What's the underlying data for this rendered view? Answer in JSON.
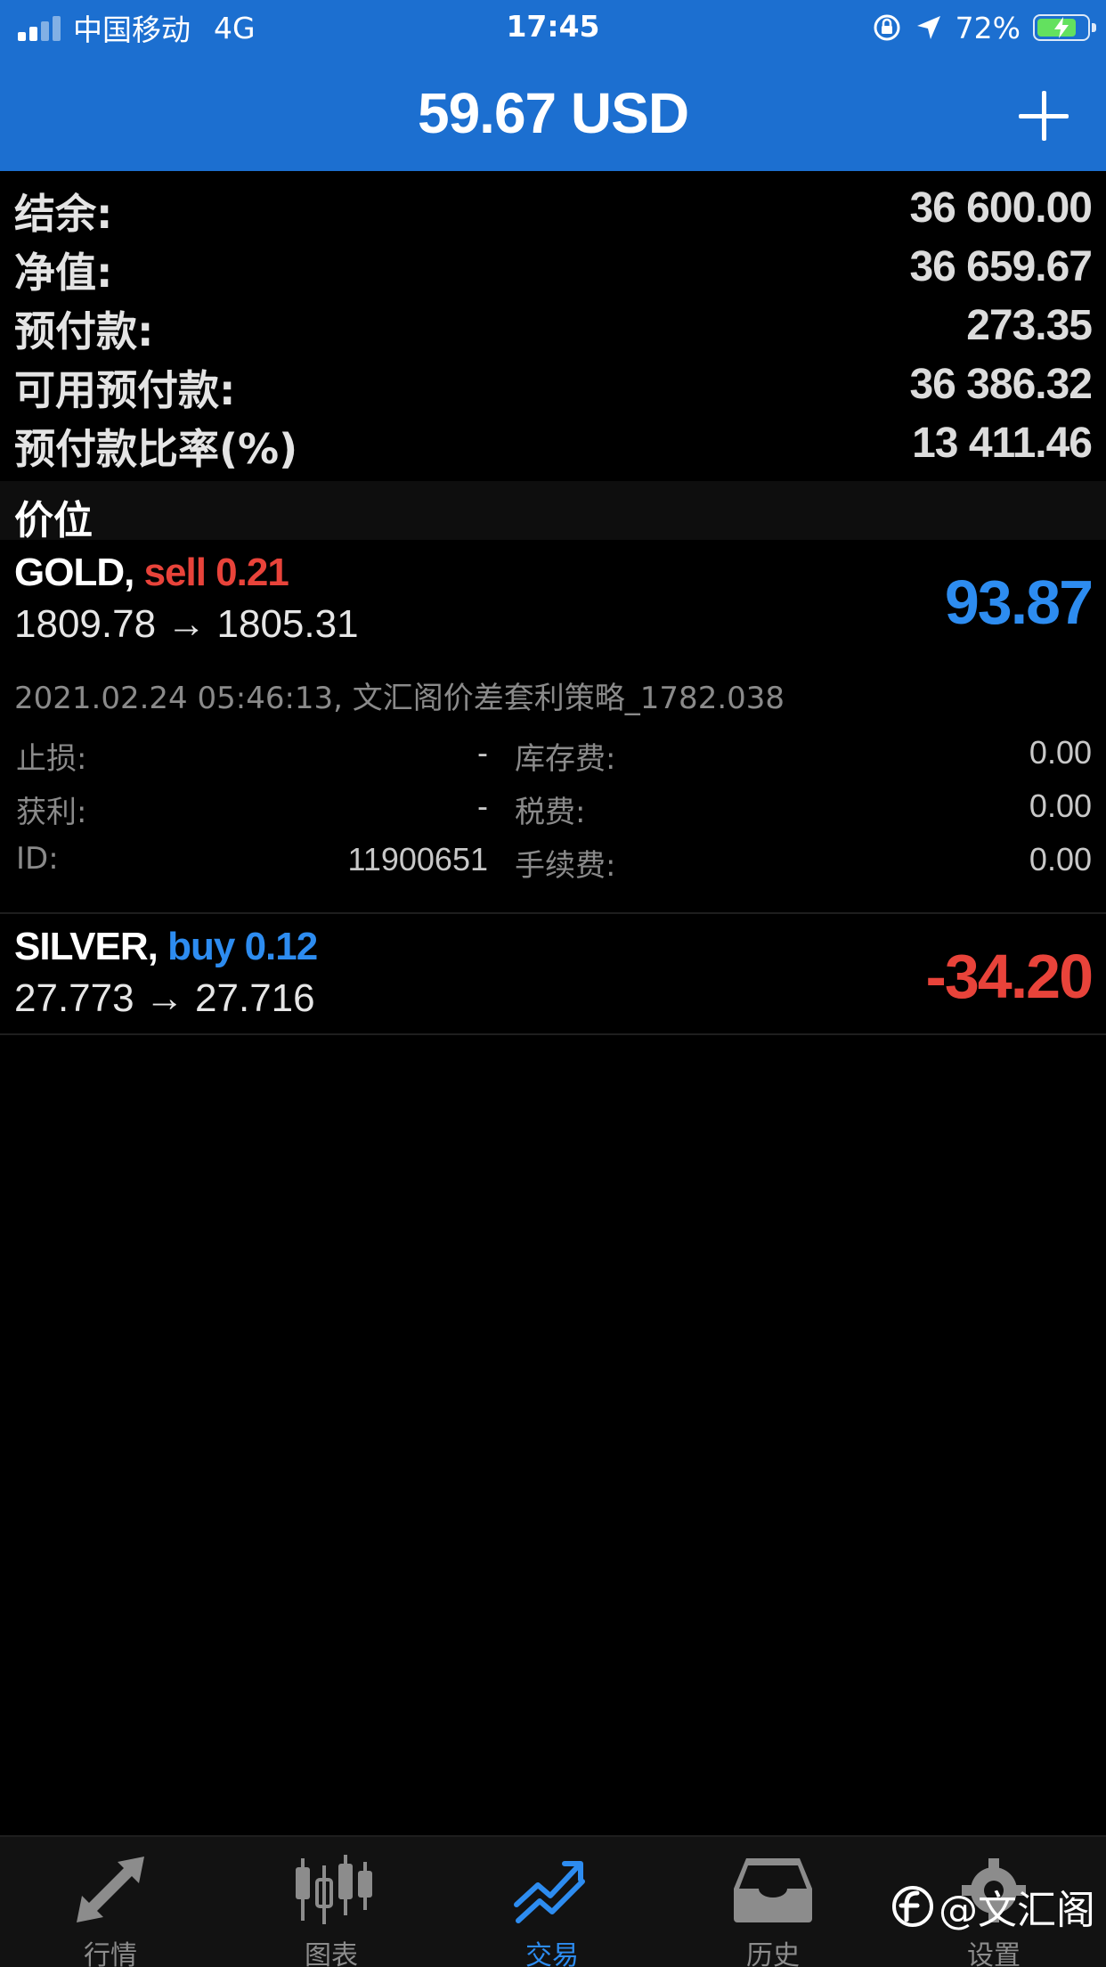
{
  "status_bar": {
    "carrier": "中国移动",
    "network": "4G",
    "time": "17:45",
    "battery": "72%"
  },
  "header": {
    "title": "59.67 USD"
  },
  "summary": [
    {
      "label": "结余:",
      "value": "36 600.00"
    },
    {
      "label": "净值:",
      "value": "36 659.67"
    },
    {
      "label": "预付款:",
      "value": "273.35"
    },
    {
      "label": "可用预付款:",
      "value": "36 386.32"
    },
    {
      "label": "预付款比率(%)",
      "value": "13 411.46"
    }
  ],
  "section": {
    "title": "价位"
  },
  "positions": [
    {
      "symbol": "GOLD,",
      "side": "sell 0.21",
      "prices": "1809.78 → 1805.31",
      "profit": "93.87",
      "comment": "2021.02.24 05:46:13, 文汇阁价差套利策略_1782.038",
      "details": {
        "sl_label": "止损:",
        "sl_value": "-",
        "tp_label": "获利:",
        "tp_value": "-",
        "id_label": "ID:",
        "id_value": "11900651",
        "swap_label": "库存费:",
        "swap_value": "0.00",
        "tax_label": "税费:",
        "tax_value": "0.00",
        "commission_label": "手续费:",
        "commission_value": "0.00"
      }
    },
    {
      "symbol": "SILVER,",
      "side": "buy 0.12",
      "prices": "27.773 → 27.716",
      "profit": "-34.20"
    }
  ],
  "tabs": [
    {
      "label": "行情",
      "icon": "quotes-arrows-icon"
    },
    {
      "label": "图表",
      "icon": "candlestick-chart-icon"
    },
    {
      "label": "交易",
      "icon": "trade-chart-icon"
    },
    {
      "label": "历史",
      "icon": "history-inbox-icon"
    },
    {
      "label": "设置",
      "icon": "gear-icon"
    }
  ],
  "watermark": "@文汇阁",
  "colors": {
    "header_blue": "#1c6fd0",
    "profit_blue": "#2d8cf0",
    "loss_red": "#e8433a"
  }
}
